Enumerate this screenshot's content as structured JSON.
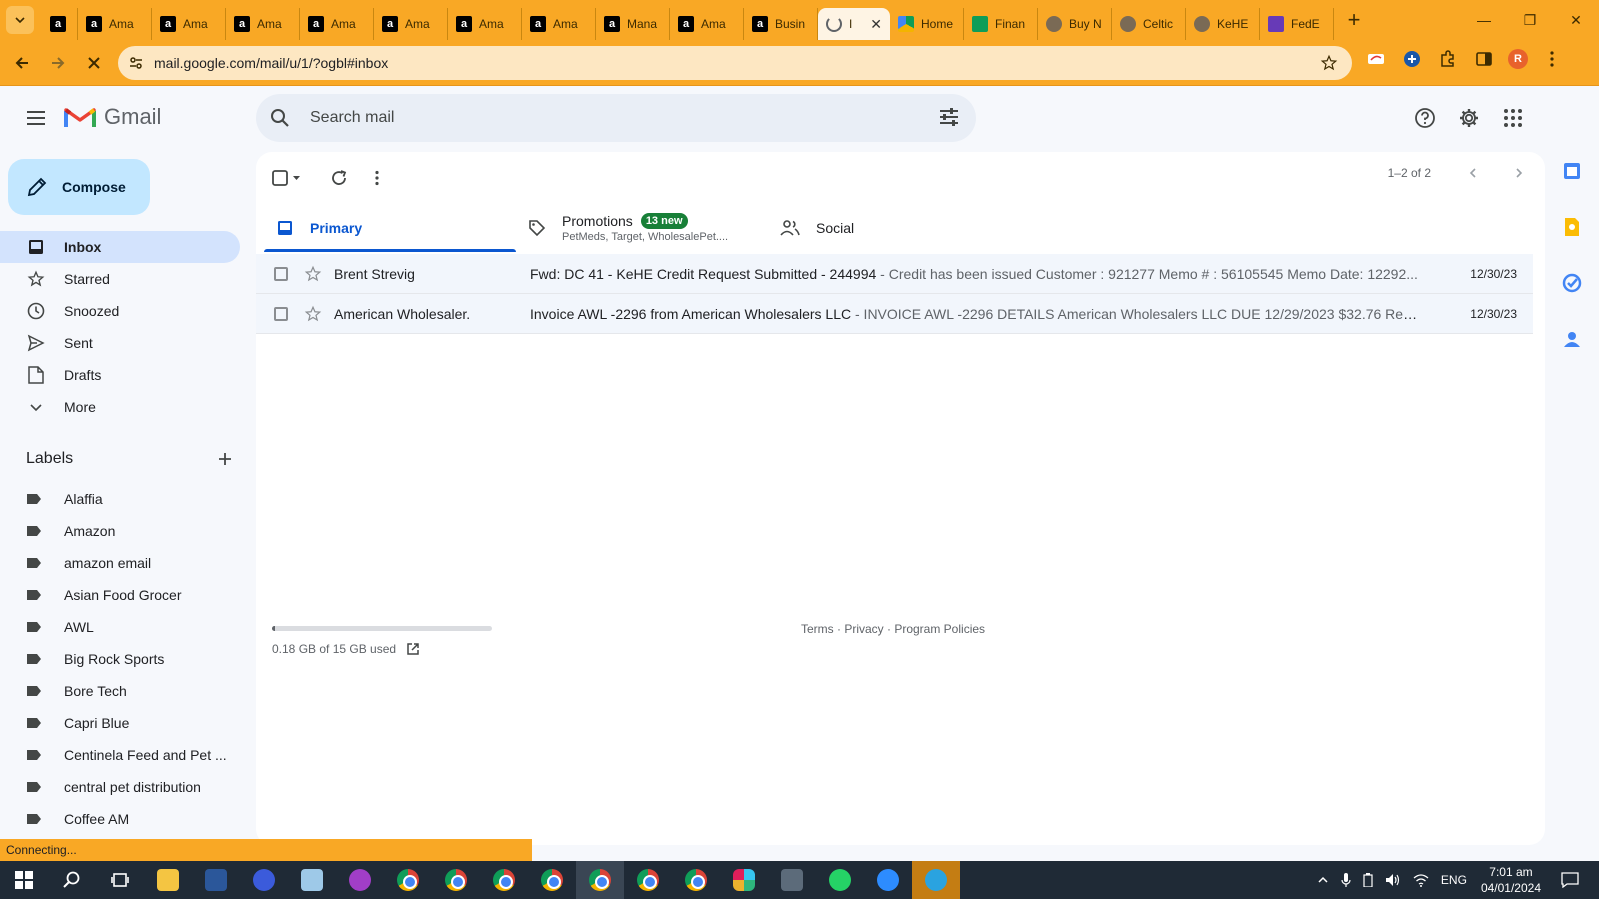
{
  "browser": {
    "tabs": [
      {
        "label": "",
        "icon": "amazon-icon"
      },
      {
        "label": "Ama",
        "icon": "amazon-icon"
      },
      {
        "label": "Ama",
        "icon": "amazon-icon"
      },
      {
        "label": "Ama",
        "icon": "amazon-icon"
      },
      {
        "label": "Ama",
        "icon": "amazon-icon"
      },
      {
        "label": "Ama",
        "icon": "amazon-icon"
      },
      {
        "label": "Ama",
        "icon": "amazon-icon"
      },
      {
        "label": "Ama",
        "icon": "amazon-icon"
      },
      {
        "label": "Mana",
        "icon": "amazon-icon"
      },
      {
        "label": "Ama",
        "icon": "amazon-icon"
      },
      {
        "label": "Busin",
        "icon": "amazon-icon"
      },
      {
        "label": "I",
        "icon": "loading-icon",
        "active": true
      },
      {
        "label": "Home",
        "icon": "drive-icon"
      },
      {
        "label": "Finan",
        "icon": "sheets-icon"
      },
      {
        "label": "Buy N",
        "icon": "globe-icon"
      },
      {
        "label": "Celtic",
        "icon": "globe-icon"
      },
      {
        "label": "KeHE",
        "icon": "globe-icon"
      },
      {
        "label": "FedE",
        "icon": "forms-icon"
      }
    ],
    "url": "mail.google.com/mail/u/1/?ogbl#inbox",
    "profile_initial": "R",
    "status_text": "Connecting..."
  },
  "gmail": {
    "logo_text": "Gmail",
    "search_placeholder": "Search mail",
    "compose_label": "Compose",
    "nav": [
      {
        "label": "Inbox",
        "icon": "inbox-icon",
        "active": true
      },
      {
        "label": "Starred",
        "icon": "star-icon"
      },
      {
        "label": "Snoozed",
        "icon": "clock-icon"
      },
      {
        "label": "Sent",
        "icon": "send-icon"
      },
      {
        "label": "Drafts",
        "icon": "draft-icon"
      },
      {
        "label": "More",
        "icon": "chevron-down-icon"
      }
    ],
    "labels_heading": "Labels",
    "labels": [
      "Alaffia",
      "Amazon",
      "amazon email",
      "Asian Food Grocer",
      "AWL",
      "Big Rock Sports",
      "Bore Tech",
      "Capri Blue",
      "Centinela Feed and Pet ...",
      "central pet distribution",
      "Coffee AM"
    ],
    "pager": "1–2 of 2",
    "category_tabs": {
      "primary": "Primary",
      "promotions": "Promotions",
      "promotions_badge": "13 new",
      "promotions_senders": "PetMeds, Target, WholesalePet....",
      "social": "Social"
    },
    "emails": [
      {
        "sender": "Brent Strevig",
        "subject": "Fwd: DC 41 - KeHE Credit Request Submitted - 244994",
        "preview": " - Credit has been issued Customer : 921277 Memo # : 56105545 Memo Date: 12292...",
        "date": "12/30/23"
      },
      {
        "sender": "American Wholesaler.",
        "subject": "Invoice AWL -2296 from American Wholesalers LLC",
        "preview": " - INVOICE AWL -2296 DETAILS American Wholesalers LLC DUE 12/29/2023 $32.76 Revi...",
        "date": "12/30/23"
      }
    ],
    "storage_text": "0.18 GB of 15 GB used",
    "storage_fraction": 0.012,
    "policies_text": "Terms · Privacy · Program Policies"
  },
  "taskbar": {
    "language": "ENG",
    "time": "7:01 am",
    "date": "04/01/2024"
  },
  "colors": {
    "browser_frame": "#f9a825",
    "compose_bg": "#c2e7ff",
    "active_nav": "#d3e3fd",
    "primary_blue": "#0b57d0",
    "badge_green": "#188038"
  }
}
